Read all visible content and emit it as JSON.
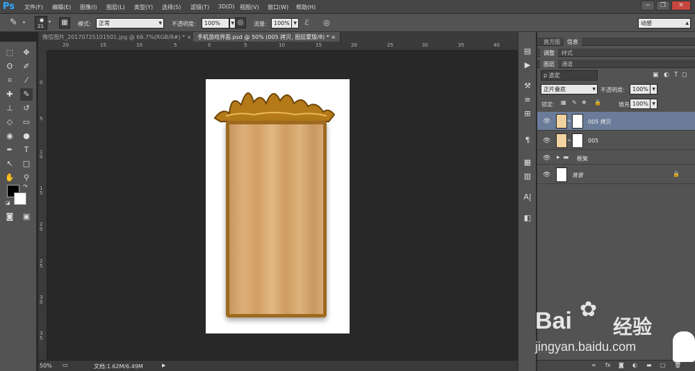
{
  "menubar": {
    "logo": "Ps",
    "items": [
      "文件(F)",
      "编辑(E)",
      "图像(I)",
      "图层(L)",
      "类型(Y)",
      "选择(S)",
      "滤镜(T)",
      "3D(D)",
      "视图(V)",
      "窗口(W)",
      "帮助(H)"
    ],
    "win_min": "−",
    "win_restore": "❐",
    "win_close": "✕"
  },
  "options": {
    "brush_size": "21",
    "mode_label": "模式:",
    "mode_value": "正常",
    "opacity_label": "不透明度:",
    "opacity_value": "100%",
    "flow_label": "流量:",
    "flow_value": "100%",
    "workspace": "动感"
  },
  "tabs": [
    {
      "label": "微信图片_20170725101501.jpg @ 66.7%(RGB/8#) *",
      "close": "×"
    },
    {
      "label": "手机游戏界面.psd @ 50% (005 拷贝, 图层蒙版/8) *",
      "close": "×"
    }
  ],
  "ruler_top": [
    "20",
    "15",
    "10",
    "5",
    "0",
    "5",
    "10",
    "15",
    "20",
    "25",
    "30",
    "35",
    "40",
    "45",
    "50",
    "55"
  ],
  "ruler_left": [
    "0",
    "5",
    "1 0",
    "1 5",
    "2 0",
    "2 5",
    "3 0",
    "3 5"
  ],
  "status": {
    "zoom": "50%",
    "doc": "文档:1.62M/6.49M"
  },
  "panels": {
    "top_tabs": [
      "直方图",
      "信息"
    ],
    "mid_tabs": [
      "调整",
      "样式"
    ],
    "layer_tabs": [
      "图层",
      "通道"
    ],
    "filter": "ρ 选定",
    "blend_mode": "正片叠底",
    "opacity_label": "不透明度:",
    "opacity_value": "100%",
    "lock_label": "锁定:",
    "fill_label": "填充:",
    "fill_value": "100%",
    "layers": [
      {
        "name": "005 拷贝"
      },
      {
        "name": "005"
      },
      {
        "name": "框架"
      },
      {
        "name": "背景"
      }
    ]
  },
  "watermark": {
    "brand": "Bai",
    "brand2": "经验",
    "url": "jingyan.baidu.com"
  },
  "colors": {
    "accent": "#31a8ff",
    "wood": "#d8aa73",
    "frame": "#9d6a1f",
    "selected_layer": "#6a7c99"
  }
}
